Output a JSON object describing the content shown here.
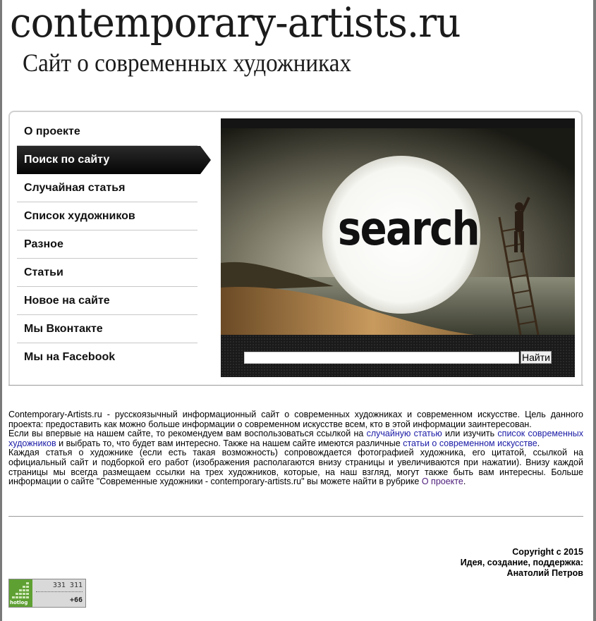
{
  "header": {
    "logo_title": "contemporary-artists.ru",
    "logo_subtitle": "Сайт о современных художниках"
  },
  "menu": [
    {
      "label": "О проекте",
      "active": false
    },
    {
      "label": "Поиск по сайту",
      "active": true
    },
    {
      "label": "Случайная статья",
      "active": false
    },
    {
      "label": "Список художников",
      "active": false
    },
    {
      "label": "Разное",
      "active": false
    },
    {
      "label": "Статьи",
      "active": false
    },
    {
      "label": "Новое на сайте",
      "active": false
    },
    {
      "label": "Мы Вконтакте",
      "active": false
    },
    {
      "label": "Мы на Facebook",
      "active": false
    }
  ],
  "search": {
    "image_word": "search",
    "input_value": "",
    "button_label": "Найти"
  },
  "content": {
    "p1": "Contemporary-Artists.ru - русскоязычный информационный сайт о современных художниках и современном искусстве. Цель данного проекта: предоставить как можно больше информации о современном искусстве всем, кто в этой информации заинтересован.",
    "p2_a": "Если вы впервые на нашем сайте, то рекомендуем вам воспользоваться ссылкой на ",
    "p2_link1": "случайную статью",
    "p2_b": " или изучить ",
    "p2_link2": "список современных художников",
    "p2_c": " и выбрать то, что будет вам интересно. Также на нашем сайте имеются различные ",
    "p2_link3": "статьи о современном искусстве",
    "p2_d": ".",
    "p3_a": "Каждая статья о художнике (если есть такая возможность) сопровождается фотографией художника, его цитатой, ссылкой на официальный сайт и подборкой его работ (изображения располагаются внизу страницы и увеличиваются при нажатии). Внизу каждой страницы мы всегда размещаем ссылки на трех художников, которые, на наш взгляд, могут также быть вам интересны. Больше информации о сайте \"Современные художники - contemporary-artists.ru\" вы можете найти в рубрике ",
    "p3_link": "О проекте",
    "p3_b": "."
  },
  "footer": {
    "line1": "Copyright c 2015",
    "line2": "Идея, создание, поддержка:",
    "line3": "Анатолий Петров"
  },
  "counter": {
    "logo_text": "hotlog",
    "total": "331 311",
    "today": "+66",
    "brand_color": "#5fa033"
  }
}
